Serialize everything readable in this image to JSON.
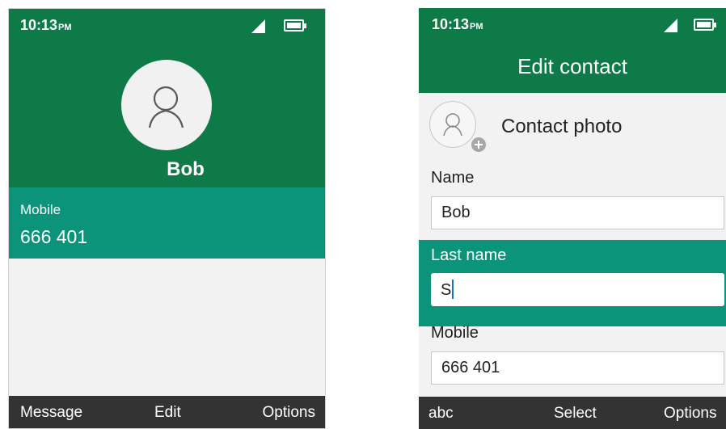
{
  "status_bar": {
    "time": "10:13",
    "ampm": "PM"
  },
  "contact_view": {
    "name": "Bob",
    "mobile_label": "Mobile",
    "mobile_value": "666 401",
    "softkeys": {
      "left": "Message",
      "center": "Edit",
      "right": "Options"
    }
  },
  "edit_contact": {
    "title": "Edit contact",
    "photo_label": "Contact photo",
    "fields": [
      {
        "label": "Name",
        "value": "Bob"
      },
      {
        "label": "Last name",
        "value": "S"
      },
      {
        "label": "Mobile",
        "value": "666 401"
      }
    ],
    "softkeys": {
      "left": "abc",
      "center": "Select",
      "right": "Options"
    }
  },
  "colors": {
    "header_green": "#0e7a48",
    "highlight_teal": "#0b9479",
    "softkey_bar": "#333333",
    "background": "#f2f2f2"
  }
}
